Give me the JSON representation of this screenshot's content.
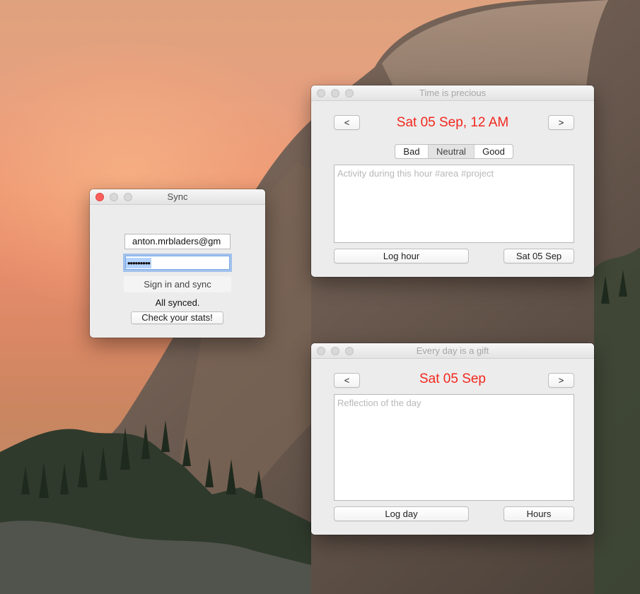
{
  "colors": {
    "accent_heading": "#f2281f",
    "close_red": "#fc605c",
    "focus_blue": "#7aa8e8"
  },
  "sync_window": {
    "title": "Sync",
    "email_value": "anton.mrbladers@gm",
    "password_value": "•••••••••",
    "sign_in_label": "Sign in and sync",
    "status_text": "All synced.",
    "stats_label": "Check your stats!"
  },
  "hour_window": {
    "title": "Time is precious",
    "prev_label": "<",
    "next_label": ">",
    "heading": "Sat 05 Sep, 12 AM",
    "mood": {
      "options": [
        "Bad",
        "Neutral",
        "Good"
      ],
      "selected": "Neutral"
    },
    "activity_placeholder": "Activity during this hour #area #project",
    "log_label": "Log hour",
    "date_label": "Sat 05 Sep"
  },
  "day_window": {
    "title": "Every day is a gift",
    "prev_label": "<",
    "next_label": ">",
    "heading": "Sat 05 Sep",
    "reflection_placeholder": "Reflection of the day",
    "log_label": "Log day",
    "hours_label": "Hours"
  }
}
